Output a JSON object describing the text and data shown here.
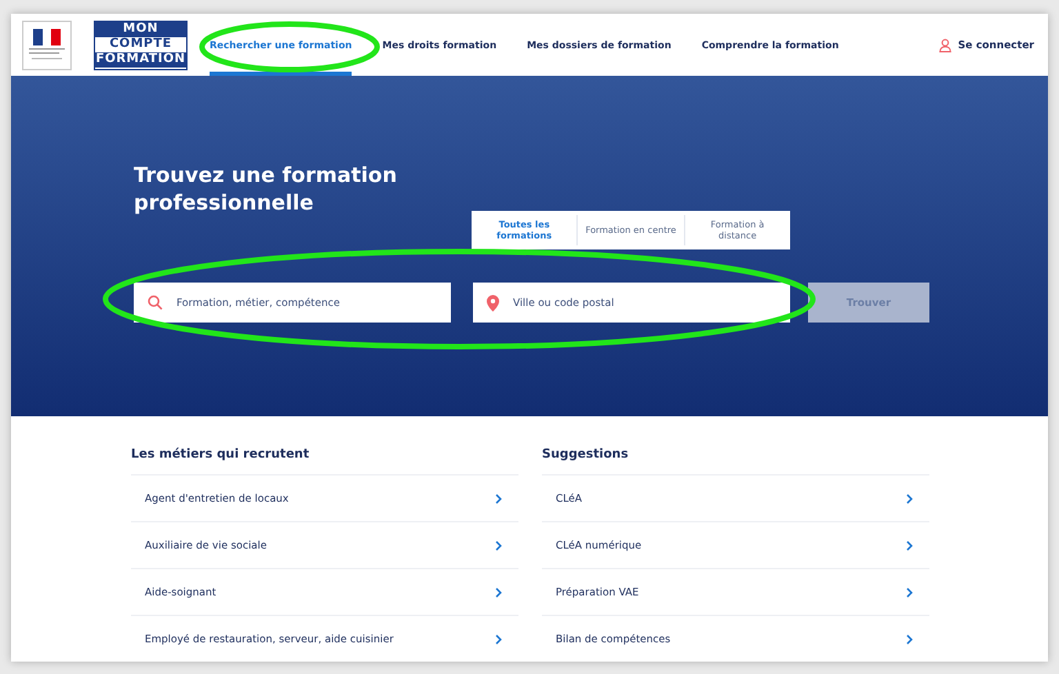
{
  "header": {
    "brand": [
      "MON",
      "COMPTE",
      "FORMATION"
    ],
    "nav": [
      {
        "label": "Rechercher une formation",
        "selected": true
      },
      {
        "label": "Mes droits formation",
        "selected": false
      },
      {
        "label": "Mes dossiers de formation",
        "selected": false
      },
      {
        "label": "Comprendre la formation",
        "selected": false
      }
    ],
    "login": "Se connecter"
  },
  "hero": {
    "title": "Trouvez une formation professionnelle",
    "modes": [
      {
        "label": "Toutes les formations",
        "selected": true
      },
      {
        "label": "Formation en centre",
        "selected": false
      },
      {
        "label": "Formation à distance",
        "selected": false
      }
    ],
    "search": {
      "placeholder": "Formation, métier, compétence"
    },
    "location": {
      "placeholder": "Ville ou code postal"
    },
    "button": {
      "label": "Trouver",
      "disabled": true
    }
  },
  "lists": [
    {
      "title": "Les métiers qui recrutent",
      "items": [
        "Agent d'entretien de locaux",
        "Auxiliaire de vie sociale",
        "Aide-soignant",
        "Employé de restauration, serveur, aide cuisinier"
      ]
    },
    {
      "title": "Suggestions",
      "items": [
        "CLéA",
        "CLéA numérique",
        "Préparation VAE",
        "Bilan de compétences"
      ]
    }
  ],
  "annotations": [
    {
      "kind": "ellipse"
    },
    {
      "kind": "ellipse"
    }
  ]
}
